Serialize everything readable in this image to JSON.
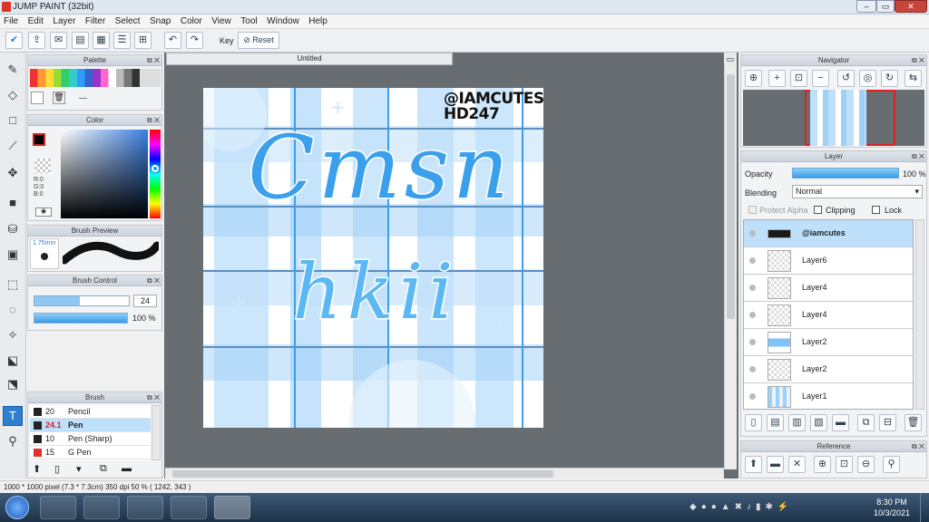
{
  "window": {
    "title": "JUMP PAINT (32bit)"
  },
  "menu": [
    "File",
    "Edit",
    "Layer",
    "Filter",
    "Select",
    "Snap",
    "Color",
    "View",
    "Tool",
    "Window",
    "Help"
  ],
  "toolbar": {
    "key_label": "Key",
    "reset_label": "Reset"
  },
  "panels": {
    "palette": "Palette",
    "palette_preset": "---",
    "color": "Color",
    "rgb": [
      "R:0",
      "G:0",
      "B:0"
    ],
    "brush_preview": "Brush Preview",
    "brush_preview_size": "1.75mm",
    "brush_control": "Brush Control",
    "brush_size": "24",
    "brush_opacity": "100 %",
    "brush": "Brush",
    "navigator": "Navigator",
    "layer": "Layer",
    "reference": "Reference"
  },
  "brushes": [
    {
      "size": "20",
      "name": "Pencil",
      "color": "#222222"
    },
    {
      "size": "24.1",
      "name": "Pen",
      "color": "#222222",
      "selected": true
    },
    {
      "size": "10",
      "name": "Pen (Sharp)",
      "color": "#222222"
    },
    {
      "size": "15",
      "name": "G Pen",
      "color": "#e03030"
    }
  ],
  "document": {
    "tab": "Untitled"
  },
  "artwork": {
    "handle": "@IAMCUTES",
    "handle2": "HD247",
    "word1": "Cmsn",
    "word2": "hkii"
  },
  "layer_panel": {
    "opacity_label": "Opacity",
    "opacity_value": "100 %",
    "blending_label": "Blending",
    "blending_value": "Normal",
    "protect_alpha": "Protect Alpha",
    "clipping": "Clipping",
    "lock": "Lock",
    "layers": [
      {
        "name": "@iamcutes",
        "selected": true
      },
      {
        "name": "Layer6"
      },
      {
        "name": "Layer4"
      },
      {
        "name": "Layer4"
      },
      {
        "name": "Layer2"
      },
      {
        "name": "Layer2"
      },
      {
        "name": "Layer1"
      }
    ]
  },
  "status": "1000 * 1000 pixel   (7.3 * 7.3cm)   350 dpi   50 %   ( 1242, 343 )",
  "taskbar": {
    "time": "8:30 PM",
    "date": "10/3/2021"
  },
  "colors": {
    "accent": "#2f7fd0",
    "plaid_light": "#cfe6fb",
    "plaid_mid": "#9fd0f7",
    "text_blue": "#3aa0ec"
  }
}
